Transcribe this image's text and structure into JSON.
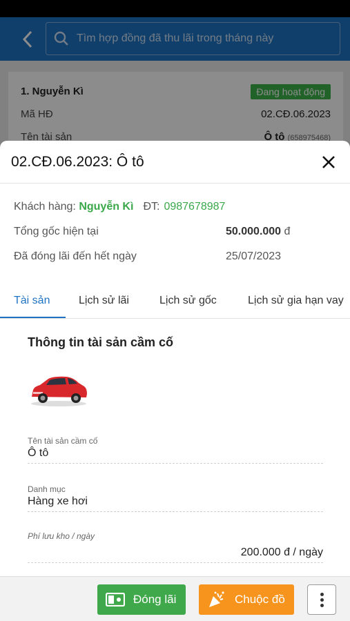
{
  "search": {
    "placeholder": "Tìm hợp đồng đã thu lãi trong tháng này"
  },
  "background_card": {
    "customer": "1. Nguyễn Kì",
    "status_badge": "Đang hoạt động",
    "contract_label": "Mã HĐ",
    "contract_value": "02.CĐ.06.2023",
    "asset_label": "Tên tài sản",
    "asset_value": "Ô tô",
    "asset_code": "(658975468)"
  },
  "sheet": {
    "title": "02.CĐ.06.2023: Ô tô",
    "customer_label": "Khách hàng:",
    "customer_name": "Nguyễn Kì",
    "phone_label": "ĐT:",
    "phone_value": "0987678987",
    "principal_label": "Tổng gốc hiện tại",
    "principal_value": "50.000.000",
    "currency": "đ",
    "paid_until_label": "Đã đóng lãi đến hết ngày",
    "paid_until_value": "25/07/2023"
  },
  "tabs": [
    {
      "label": "Tài sản",
      "active": true
    },
    {
      "label": "Lịch sử lãi",
      "active": false
    },
    {
      "label": "Lịch sử gốc",
      "active": false
    },
    {
      "label": "Lịch sử gia hạn vay",
      "active": false
    }
  ],
  "asset_info": {
    "section_title": "Thông tin tài sản cầm cố",
    "asset_name_label": "Tên tài sản cầm cố",
    "asset_name_value": "Ô tô",
    "category_label": "Danh mục",
    "category_value": "Hàng xe hơi",
    "storage_fee_label": "Phí lưu kho / ngày",
    "storage_fee_value": "200.000 đ / ngày"
  },
  "actions": {
    "pay_interest": "Đóng lãi",
    "redeem": "Chuộc đồ"
  },
  "colors": {
    "primary": "#1f73c4",
    "green": "#3fa84a",
    "orange": "#f7941d"
  }
}
